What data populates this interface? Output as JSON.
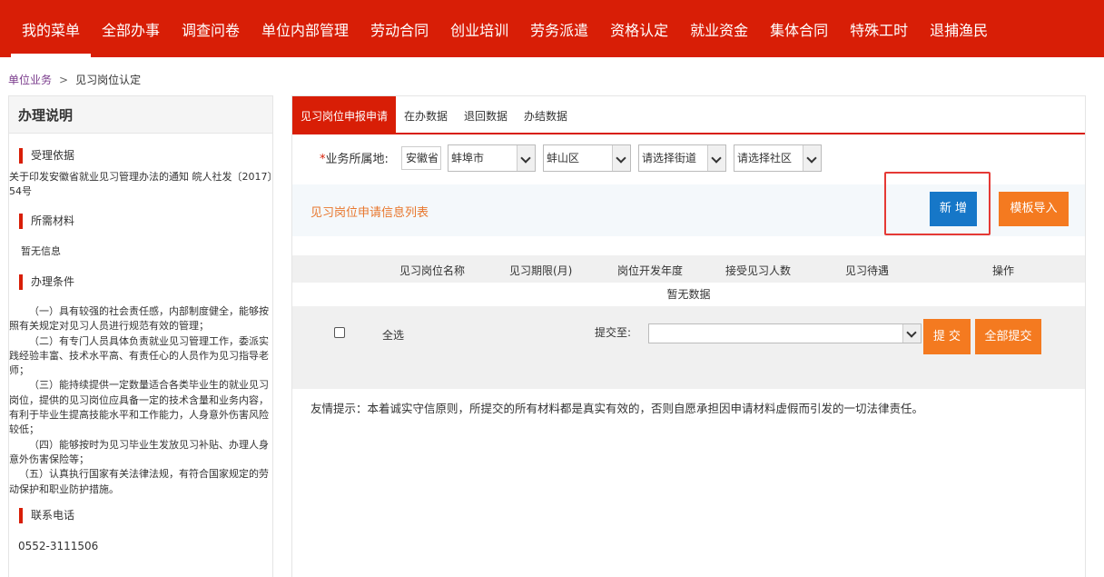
{
  "nav": {
    "items": [
      "我的菜单",
      "全部办事",
      "调查问卷",
      "单位内部管理",
      "劳动合同",
      "创业培训",
      "劳务派遣",
      "资格认定",
      "就业资金",
      "集体合同",
      "特殊工时",
      "退捕渔民"
    ],
    "active_index": 0
  },
  "breadcrumb": {
    "parent": "单位业务",
    "separator": ">",
    "current": "见习岗位认定"
  },
  "sidebar": {
    "title": "办理说明",
    "basis_head": "受理依据",
    "basis_text": "关于印发安徽省就业见习管理办法的通知 皖人社发〔2017〕54号",
    "materials_head": "所需材料",
    "materials_text": "暂无信息",
    "conditions_head": "办理条件",
    "conditions": [
      "（一）具有较强的社会责任感，内部制度健全，能够按照有关规定对见习人员进行规范有效的管理；",
      "（二）有专门人员具体负责就业见习管理工作，委派实践经验丰富、技术水平高、有责任心的人员作为见习指导老师；",
      "（三）能持续提供一定数量适合各类毕业生的就业见习岗位，提供的见习岗位应具备一定的技术含量和业务内容，有利于毕业生提高技能水平和工作能力，人身意外伤害风险较低；",
      "（四）能够按时为见习毕业生发放见习补贴、办理人身意外伤害保险等；",
      "（五）认真执行国家有关法律法规，有符合国家规定的劳动保护和职业防护措施。"
    ],
    "phone_head": "联系电话",
    "phone": "0552-3111506"
  },
  "tabs": [
    "见习岗位申报申请",
    "在办数据",
    "退回数据",
    "办结数据"
  ],
  "region": {
    "required_mark": "*",
    "label": "业务所属地:",
    "province": "安徽省",
    "city": "蚌埠市",
    "district": "蚌山区",
    "street": "请选择街道",
    "community": "请选择社区"
  },
  "list": {
    "title": "见习岗位申请信息列表",
    "add_label": "新 增",
    "import_label": "模板导入"
  },
  "table": {
    "headers": [
      "见习岗位名称",
      "见习期限(月)",
      "岗位开发年度",
      "接受见习人数",
      "见习待遇",
      "操作"
    ],
    "empty_text": "暂无数据"
  },
  "submit": {
    "select_all": "全选",
    "submit_to_label": "提交至:",
    "submit_to_value": "",
    "submit_label": "提 交",
    "submit_all_label": "全部提交"
  },
  "tip": "友情提示：本着诚实守信原则，所提交的所有材料都是真实有效的，否则自愿承担因申请材料虚假而引发的一切法律责任。"
}
